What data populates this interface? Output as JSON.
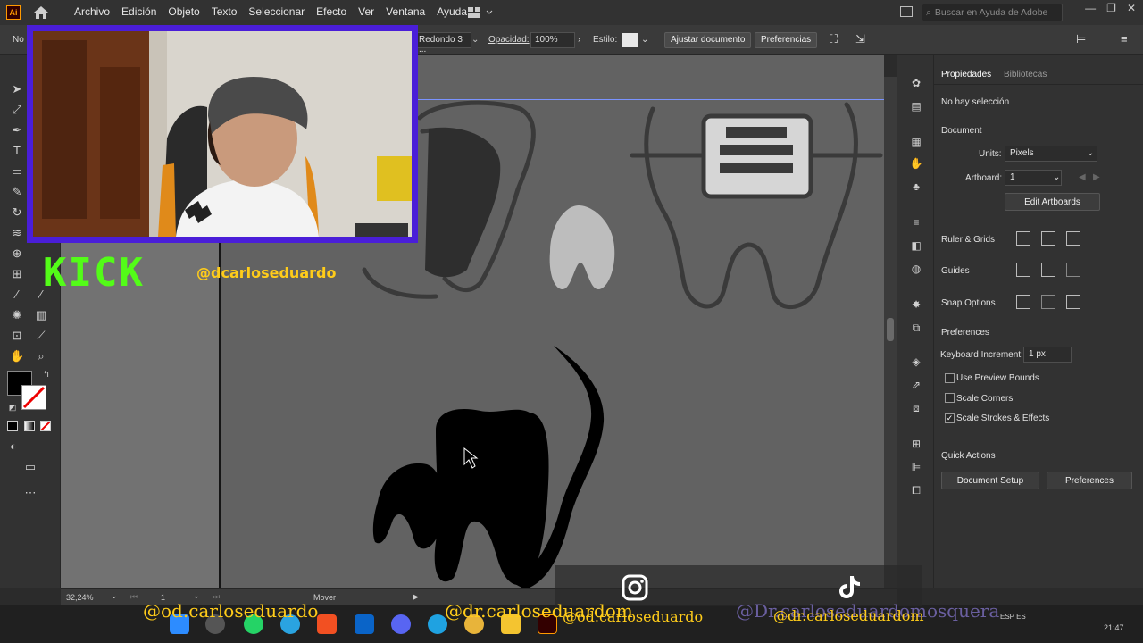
{
  "menubar": {
    "app_logo": "Ai",
    "menus": [
      "Archivo",
      "Edición",
      "Objeto",
      "Texto",
      "Seleccionar",
      "Efecto",
      "Ver",
      "Ventana",
      "Ayuda"
    ],
    "help_placeholder": "Buscar en Ayuda de Adobe"
  },
  "controlbar": {
    "selection_state": "No",
    "stroke_style": "Redondo 3 ...",
    "opacity_label": "Opacidad:",
    "opacity_value": "100%",
    "style_label": "Estilo:",
    "fit_document_button": "Ajustar documento",
    "preferences_button": "Preferencias"
  },
  "properties_panel": {
    "tabs": [
      "Propiedades",
      "Bibliotecas"
    ],
    "no_selection": "No hay selección",
    "document_heading": "Document",
    "units_label": "Units:",
    "units_value": "Pixels",
    "artboard_label": "Artboard:",
    "artboard_value": "1",
    "edit_artboards_button": "Edit Artboards",
    "rulers_grids_label": "Ruler & Grids",
    "guides_label": "Guides",
    "snap_options_label": "Snap Options",
    "preferences_heading": "Preferences",
    "keyboard_increment_label": "Keyboard Increment:",
    "keyboard_increment_value": "1 px",
    "checkboxes": [
      {
        "label": "Use Preview Bounds",
        "checked": false
      },
      {
        "label": "Scale Corners",
        "checked": false
      },
      {
        "label": "Scale Strokes & Effects",
        "checked": true
      }
    ],
    "quick_actions_heading": "Quick Actions",
    "document_setup_button": "Document Setup",
    "preferences_button": "Preferences"
  },
  "statusbar": {
    "zoom": "32,24%",
    "artboard": "1",
    "tool": "Mover"
  },
  "overlay": {
    "kick_logo": "KICK",
    "kick_handle": "@dcarloseduardo",
    "handle_1": "@od.carloseduardo",
    "handle_2": "@dr.carloseduardom",
    "handle_3": "@od.carloseduardo",
    "handle_4": "@Dr.carloseduardomosquera",
    "handle_5": "@dr.carloseduardom"
  },
  "taskbar": {
    "language": "ESP ES",
    "time": "21:47"
  },
  "colors": {
    "kick_green": "#53fc18",
    "overlay_yellow": "#ffcc1a",
    "webcam_border": "#4a1ed8",
    "ai_logo": "#ff9a00"
  }
}
